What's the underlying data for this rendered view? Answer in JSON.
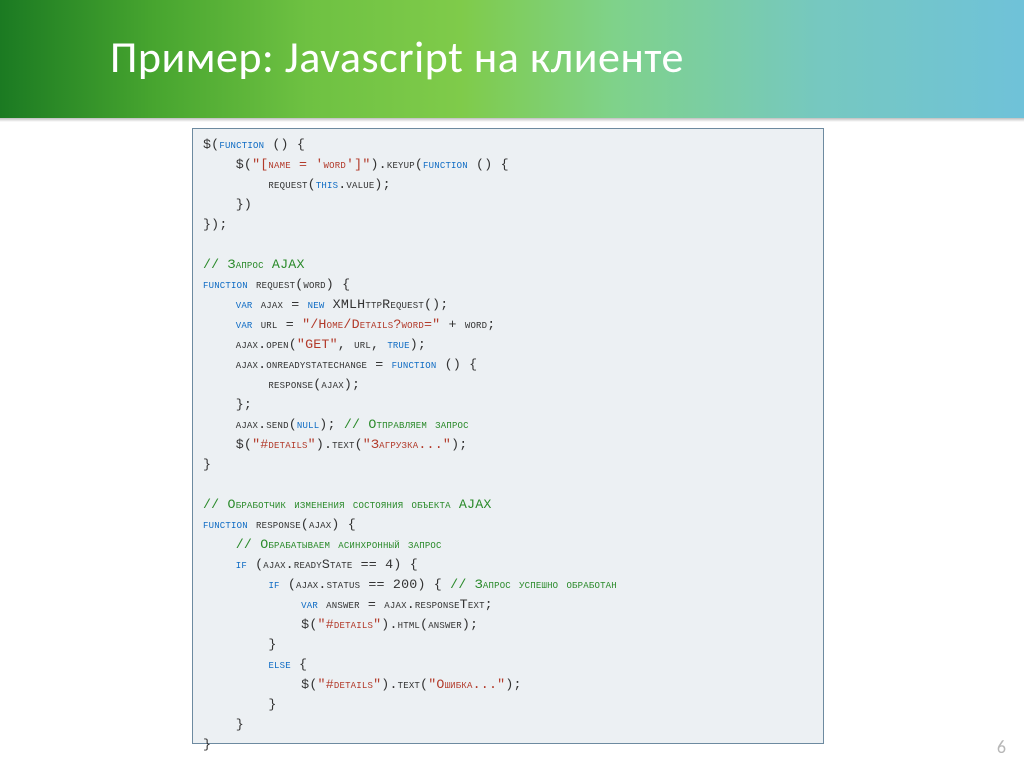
{
  "title": "Пример: Javascript на клиенте",
  "slideNumber": "6",
  "code": {
    "lines": [
      [
        [
          "pl",
          "$("
        ],
        [
          "kw",
          "function"
        ],
        [
          "pl",
          " () {"
        ]
      ],
      [
        [
          "pl",
          "    $("
        ],
        [
          "str",
          "\"[name = 'word']\""
        ],
        [
          "pl",
          ").keyup("
        ],
        [
          "kw",
          "function"
        ],
        [
          "pl",
          " () {"
        ]
      ],
      [
        [
          "pl",
          "        request("
        ],
        [
          "kw",
          "this"
        ],
        [
          "pl",
          ".value);"
        ]
      ],
      [
        [
          "pl",
          "    })"
        ]
      ],
      [
        [
          "pl",
          "});"
        ]
      ],
      [
        [
          "pl",
          ""
        ]
      ],
      [
        [
          "cmt",
          "// Запрос AJAX"
        ]
      ],
      [
        [
          "kw",
          "function"
        ],
        [
          "pl",
          " request(word) {"
        ]
      ],
      [
        [
          "pl",
          "    "
        ],
        [
          "kw",
          "var"
        ],
        [
          "pl",
          " ajax = "
        ],
        [
          "kw",
          "new"
        ],
        [
          "pl",
          " XMLHttpRequest();"
        ]
      ],
      [
        [
          "pl",
          "    "
        ],
        [
          "kw",
          "var"
        ],
        [
          "pl",
          " url = "
        ],
        [
          "str",
          "\"/Home/Details?word=\""
        ],
        [
          "pl",
          " + word;"
        ]
      ],
      [
        [
          "pl",
          "    ajax.open("
        ],
        [
          "str",
          "\"GET\""
        ],
        [
          "pl",
          ", url, "
        ],
        [
          "kw",
          "true"
        ],
        [
          "pl",
          ");"
        ]
      ],
      [
        [
          "pl",
          "    ajax.onreadystatechange = "
        ],
        [
          "kw",
          "function"
        ],
        [
          "pl",
          " () {"
        ]
      ],
      [
        [
          "pl",
          "        response(ajax);"
        ]
      ],
      [
        [
          "pl",
          "    };"
        ]
      ],
      [
        [
          "pl",
          "    ajax.send("
        ],
        [
          "kw",
          "null"
        ],
        [
          "pl",
          "); "
        ],
        [
          "cmt",
          "// Отправляем запрос"
        ]
      ],
      [
        [
          "pl",
          "    $("
        ],
        [
          "str",
          "\"#details\""
        ],
        [
          "pl",
          ").text("
        ],
        [
          "str",
          "\"Загрузка...\""
        ],
        [
          "pl",
          ");"
        ]
      ],
      [
        [
          "pl",
          "}"
        ]
      ],
      [
        [
          "pl",
          ""
        ]
      ],
      [
        [
          "cmt",
          "// Обработчик изменения состояния объекта AJAX"
        ]
      ],
      [
        [
          "kw",
          "function"
        ],
        [
          "pl",
          " response(ajax) {"
        ]
      ],
      [
        [
          "pl",
          "    "
        ],
        [
          "cmt",
          "// Обрабатываем асинхронный запрос"
        ]
      ],
      [
        [
          "pl",
          "    "
        ],
        [
          "kw",
          "if"
        ],
        [
          "pl",
          " (ajax.readyState == 4) {"
        ]
      ],
      [
        [
          "pl",
          "        "
        ],
        [
          "kw",
          "if"
        ],
        [
          "pl",
          " (ajax.status == 200) { "
        ],
        [
          "cmt",
          "// Запрос успешно обработан"
        ]
      ],
      [
        [
          "pl",
          "            "
        ],
        [
          "kw",
          "var"
        ],
        [
          "pl",
          " answer = ajax.responseText;"
        ]
      ],
      [
        [
          "pl",
          "            $("
        ],
        [
          "str",
          "\"#details\""
        ],
        [
          "pl",
          ").html(answer);"
        ]
      ],
      [
        [
          "pl",
          "        }"
        ]
      ],
      [
        [
          "pl",
          "        "
        ],
        [
          "kw",
          "else"
        ],
        [
          "pl",
          " {"
        ]
      ],
      [
        [
          "pl",
          "            $("
        ],
        [
          "str",
          "\"#details\""
        ],
        [
          "pl",
          ").text("
        ],
        [
          "str",
          "\"Ошибка...\""
        ],
        [
          "pl",
          ");"
        ]
      ],
      [
        [
          "pl",
          "        }"
        ]
      ],
      [
        [
          "pl",
          "    }"
        ]
      ],
      [
        [
          "pl",
          "}"
        ]
      ]
    ]
  }
}
